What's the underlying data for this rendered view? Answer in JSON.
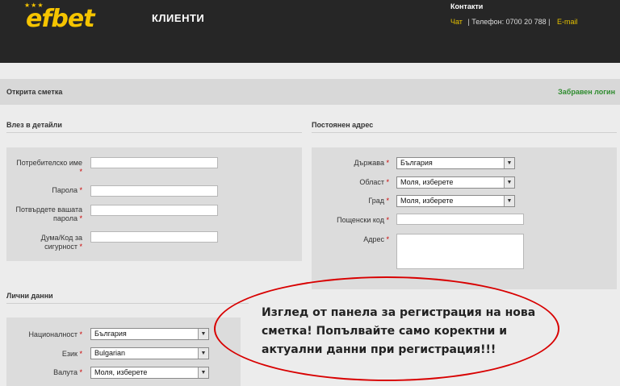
{
  "header": {
    "logo": "efbet",
    "logo_stars": "★★★",
    "subtitle": "КЛИЕНТИ",
    "contacts_title": "Контакти",
    "chat": "Чат",
    "phone": "| Телефон: 0700 20 788 |",
    "email": "E-mail"
  },
  "bar": {
    "title": "Открита сметка",
    "forgot": "Забравен логин"
  },
  "login": {
    "title": "Влез в детайли",
    "fields": [
      {
        "label": "Потребителско име",
        "value": ""
      },
      {
        "label": "Парола",
        "value": ""
      },
      {
        "label": "Потвърдете вашата парола",
        "value": ""
      },
      {
        "label": "Дума/Код за сигурност",
        "value": ""
      }
    ]
  },
  "address": {
    "title": "Постоянен адрес",
    "country_label": "Държава",
    "country_value": "България",
    "region_label": "Област",
    "region_value": "Моля, изберете",
    "city_label": "Град",
    "city_value": "Моля, изберете",
    "postcode_label": "Пощенски код",
    "address_label": "Адрес"
  },
  "personal": {
    "title": "Лични данни",
    "nationality_label": "Националност",
    "nationality_value": "България",
    "language_label": "Език",
    "language_value": "Bulgarian",
    "currency_label": "Валута",
    "currency_value": "Моля, изберете"
  },
  "annotation": "Изглед от панела за регистрация на нова сметка! Попълвайте само коректни и актуални данни при регистрация!!!",
  "required_mark": "*",
  "colors": {
    "topbar": "#262626",
    "logo": "#f5c400",
    "accent_link": "#2e8b2e",
    "oval": "#d80000"
  }
}
